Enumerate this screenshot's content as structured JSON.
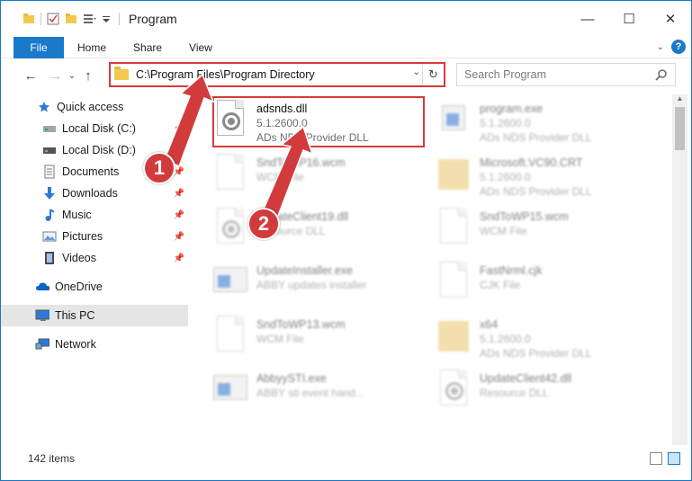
{
  "window": {
    "title": "Program",
    "controls": {
      "minimize": "—",
      "maximize": "☐",
      "close": "✕"
    }
  },
  "ribbon": {
    "file_label": "File",
    "tabs": [
      "Home",
      "Share",
      "View"
    ],
    "help_label": "?"
  },
  "nav": {
    "address": "C:\\Program Files\\Program Directory",
    "search_placeholder": "Search Program"
  },
  "sidebar": {
    "items": [
      {
        "label": "Quick access",
        "icon": "star-icon",
        "pinned": false
      },
      {
        "label": "Local Disk (C:)",
        "icon": "drive-icon",
        "pinned": true
      },
      {
        "label": "Local Disk (D:)",
        "icon": "drive-icon",
        "pinned": true
      },
      {
        "label": "Documents",
        "icon": "documents-icon",
        "pinned": true
      },
      {
        "label": "Downloads",
        "icon": "download-icon",
        "pinned": true
      },
      {
        "label": "Music",
        "icon": "music-icon",
        "pinned": true
      },
      {
        "label": "Pictures",
        "icon": "pictures-icon",
        "pinned": true
      },
      {
        "label": "Videos",
        "icon": "videos-icon",
        "pinned": true
      },
      {
        "label": "OneDrive",
        "icon": "cloud-icon",
        "pinned": false
      },
      {
        "label": "This PC",
        "icon": "computer-icon",
        "pinned": false
      },
      {
        "label": "Network",
        "icon": "network-icon",
        "pinned": false
      }
    ]
  },
  "files": [
    {
      "name": "adsnds.dll",
      "line2": "5.1.2600.0",
      "line3": "ADs NDS Provider DLL",
      "type": "dll",
      "highlighted": true
    },
    {
      "name": "program.exe",
      "line2": "5.1.2600.0",
      "line3": "ADs NDS Provider DLL",
      "type": "exe",
      "highlighted": false
    },
    {
      "name": "SndToWP16.wcm",
      "line2": "WCM File",
      "line3": "",
      "type": "doc",
      "highlighted": false
    },
    {
      "name": "Microsoft.VC90.CRT",
      "line2": "5.1.2600.0",
      "line3": "ADs NDS Provider DLL",
      "type": "folder",
      "highlighted": false
    },
    {
      "name": "UpdateClient19.dll",
      "line2": "Resource DLL",
      "line3": "",
      "type": "dll",
      "highlighted": false
    },
    {
      "name": "SndToWP15.wcm",
      "line2": "WCM File",
      "line3": "",
      "type": "doc",
      "highlighted": false
    },
    {
      "name": "UpdateInstaller.exe",
      "line2": "ABBY updates installer",
      "line3": "",
      "type": "exe",
      "highlighted": false
    },
    {
      "name": "FastNrml.cjk",
      "line2": "CJK File",
      "line3": "",
      "type": "doc",
      "highlighted": false
    },
    {
      "name": "SndToWP13.wcm",
      "line2": "WCM File",
      "line3": "",
      "type": "doc",
      "highlighted": false
    },
    {
      "name": "x64",
      "line2": "5.1.2600.0",
      "line3": "ADs NDS Provider DLL",
      "type": "folder",
      "highlighted": false
    },
    {
      "name": "AbbyySTI.exe",
      "line2": "ABBY sti event hand...",
      "line3": "",
      "type": "exe",
      "highlighted": false
    },
    {
      "name": "UpdateClient42.dll",
      "line2": "Resource DLL",
      "line3": "",
      "type": "dll",
      "highlighted": false
    }
  ],
  "annotations": {
    "step1": "1",
    "step2": "2"
  },
  "status": {
    "item_count": "142 items"
  },
  "colors": {
    "accent": "#1979ca",
    "annotation_red": "#d23b3b",
    "highlight_border": "#d63a3a"
  }
}
